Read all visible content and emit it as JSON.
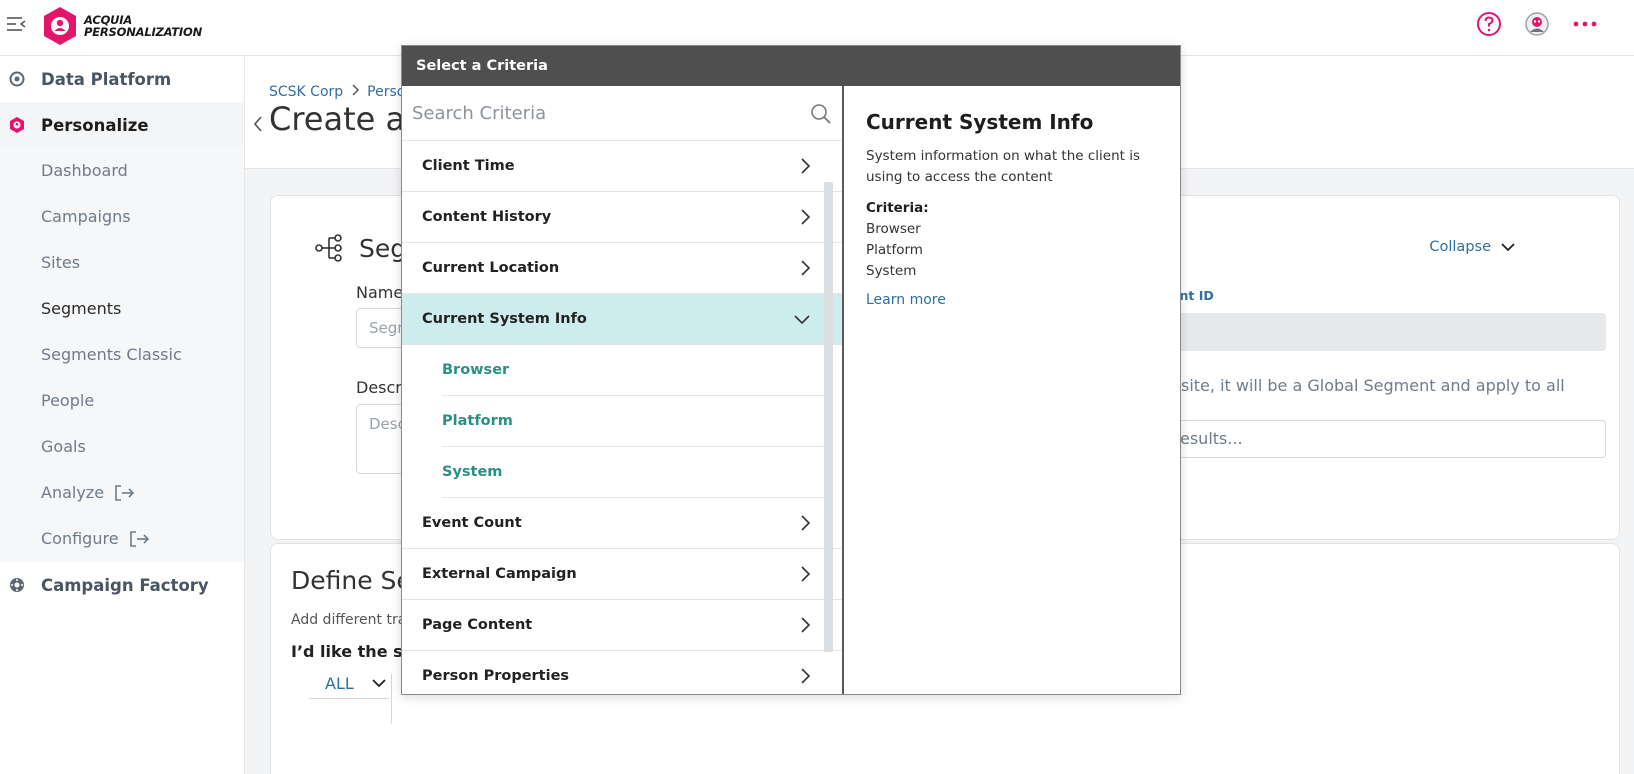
{
  "app": {
    "logo_line1": "ACQUIA",
    "logo_line2": "PERSONALIZATION",
    "brand_color": "#e2156b",
    "icons": [
      "menu-collapse-icon",
      "help-icon",
      "user-avatar-icon",
      "more-dots-icon"
    ]
  },
  "sidebar": {
    "groups": [
      {
        "label": "Data Platform",
        "icon": "data-platform-icon"
      },
      {
        "label": "Personalize",
        "icon": "personalize-icon"
      },
      {
        "label": "Campaign Factory",
        "icon": "campaign-factory-icon"
      }
    ],
    "items": [
      {
        "label": "Dashboard"
      },
      {
        "label": "Campaigns"
      },
      {
        "label": "Sites"
      },
      {
        "label": "Segments"
      },
      {
        "label": "Segments Classic"
      },
      {
        "label": "People"
      },
      {
        "label": "Goals"
      },
      {
        "label": "Analyze"
      },
      {
        "label": "Configure"
      }
    ]
  },
  "page": {
    "breadcrumb": [
      "SCSK Corp",
      "Perso"
    ],
    "title": "Create a",
    "segment_section_title": "Seg",
    "collapse_label": "Collapse",
    "name_label": "Name",
    "name_placeholder": "Segr",
    "description_label": "Descri",
    "description_placeholder": "Desc",
    "segment_id_label": "ent ID",
    "site_note": "site, it will be a Global Segment and apply to all",
    "site_input_text": "esults...",
    "define_title": "Define Se",
    "define_sub": "Add different tra",
    "like_label": "I’d like the se",
    "all_dropdown": "ALL"
  },
  "modal": {
    "title": "Select a Criteria",
    "search_placeholder": "Search Criteria",
    "rows_before": [
      {
        "label": "Client Time"
      },
      {
        "label": "Content History"
      },
      {
        "label": "Current Location"
      }
    ],
    "selected": {
      "label": "Current System Info"
    },
    "sub_items": [
      {
        "label": "Browser"
      },
      {
        "label": "Platform"
      },
      {
        "label": "System"
      }
    ],
    "rows_after": [
      {
        "label": "Event Count"
      },
      {
        "label": "External Campaign"
      },
      {
        "label": "Page Content"
      },
      {
        "label": "Person Properties"
      }
    ],
    "detail": {
      "title": "Current System Info",
      "description": "System information on what the client is using to access the content",
      "criteria_label": "Criteria:",
      "criteria": [
        "Browser",
        "Platform",
        "System"
      ],
      "learn_more": "Learn more"
    },
    "selected_bg": "#cdeced",
    "sub_item_color": "#2a9086"
  }
}
